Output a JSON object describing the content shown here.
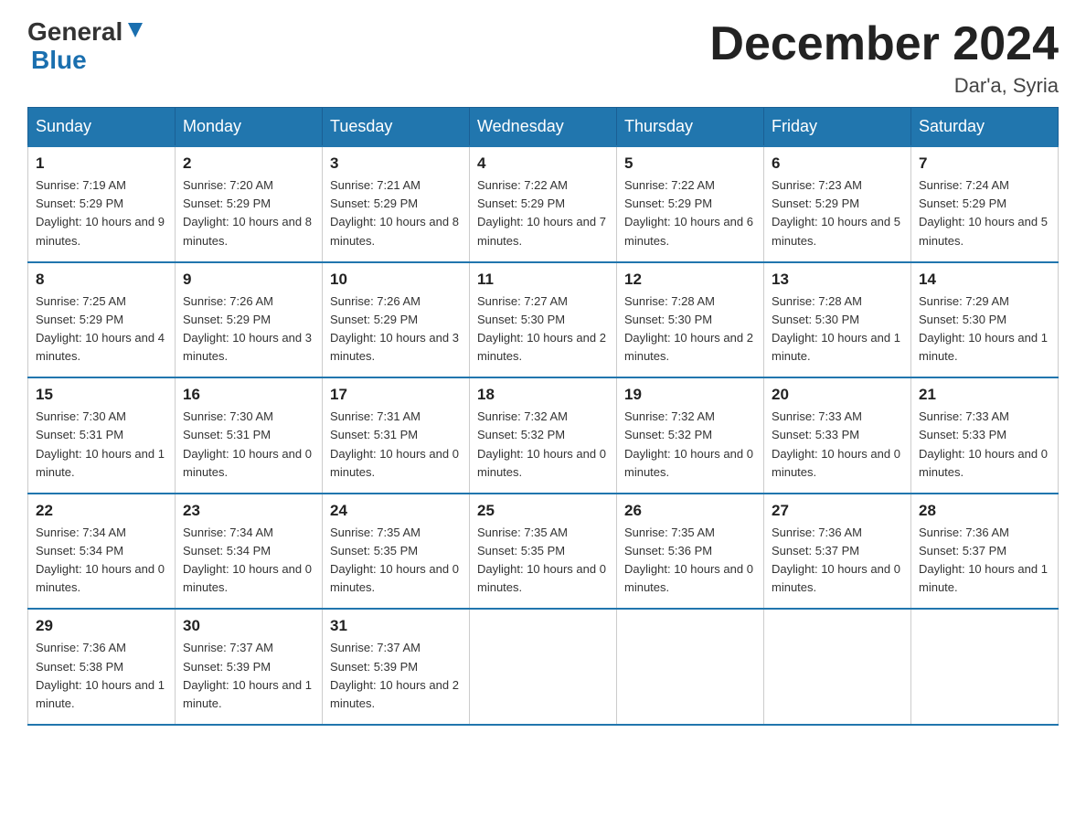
{
  "logo": {
    "text_general": "General",
    "text_blue": "Blue",
    "arrow_color": "#1a6faf"
  },
  "header": {
    "month_title": "December 2024",
    "location": "Dar'a, Syria"
  },
  "weekdays": [
    "Sunday",
    "Monday",
    "Tuesday",
    "Wednesday",
    "Thursday",
    "Friday",
    "Saturday"
  ],
  "weeks": [
    [
      {
        "day": "1",
        "sunrise": "7:19 AM",
        "sunset": "5:29 PM",
        "daylight": "10 hours and 9 minutes."
      },
      {
        "day": "2",
        "sunrise": "7:20 AM",
        "sunset": "5:29 PM",
        "daylight": "10 hours and 8 minutes."
      },
      {
        "day": "3",
        "sunrise": "7:21 AM",
        "sunset": "5:29 PM",
        "daylight": "10 hours and 8 minutes."
      },
      {
        "day": "4",
        "sunrise": "7:22 AM",
        "sunset": "5:29 PM",
        "daylight": "10 hours and 7 minutes."
      },
      {
        "day": "5",
        "sunrise": "7:22 AM",
        "sunset": "5:29 PM",
        "daylight": "10 hours and 6 minutes."
      },
      {
        "day": "6",
        "sunrise": "7:23 AM",
        "sunset": "5:29 PM",
        "daylight": "10 hours and 5 minutes."
      },
      {
        "day": "7",
        "sunrise": "7:24 AM",
        "sunset": "5:29 PM",
        "daylight": "10 hours and 5 minutes."
      }
    ],
    [
      {
        "day": "8",
        "sunrise": "7:25 AM",
        "sunset": "5:29 PM",
        "daylight": "10 hours and 4 minutes."
      },
      {
        "day": "9",
        "sunrise": "7:26 AM",
        "sunset": "5:29 PM",
        "daylight": "10 hours and 3 minutes."
      },
      {
        "day": "10",
        "sunrise": "7:26 AM",
        "sunset": "5:29 PM",
        "daylight": "10 hours and 3 minutes."
      },
      {
        "day": "11",
        "sunrise": "7:27 AM",
        "sunset": "5:30 PM",
        "daylight": "10 hours and 2 minutes."
      },
      {
        "day": "12",
        "sunrise": "7:28 AM",
        "sunset": "5:30 PM",
        "daylight": "10 hours and 2 minutes."
      },
      {
        "day": "13",
        "sunrise": "7:28 AM",
        "sunset": "5:30 PM",
        "daylight": "10 hours and 1 minute."
      },
      {
        "day": "14",
        "sunrise": "7:29 AM",
        "sunset": "5:30 PM",
        "daylight": "10 hours and 1 minute."
      }
    ],
    [
      {
        "day": "15",
        "sunrise": "7:30 AM",
        "sunset": "5:31 PM",
        "daylight": "10 hours and 1 minute."
      },
      {
        "day": "16",
        "sunrise": "7:30 AM",
        "sunset": "5:31 PM",
        "daylight": "10 hours and 0 minutes."
      },
      {
        "day": "17",
        "sunrise": "7:31 AM",
        "sunset": "5:31 PM",
        "daylight": "10 hours and 0 minutes."
      },
      {
        "day": "18",
        "sunrise": "7:32 AM",
        "sunset": "5:32 PM",
        "daylight": "10 hours and 0 minutes."
      },
      {
        "day": "19",
        "sunrise": "7:32 AM",
        "sunset": "5:32 PM",
        "daylight": "10 hours and 0 minutes."
      },
      {
        "day": "20",
        "sunrise": "7:33 AM",
        "sunset": "5:33 PM",
        "daylight": "10 hours and 0 minutes."
      },
      {
        "day": "21",
        "sunrise": "7:33 AM",
        "sunset": "5:33 PM",
        "daylight": "10 hours and 0 minutes."
      }
    ],
    [
      {
        "day": "22",
        "sunrise": "7:34 AM",
        "sunset": "5:34 PM",
        "daylight": "10 hours and 0 minutes."
      },
      {
        "day": "23",
        "sunrise": "7:34 AM",
        "sunset": "5:34 PM",
        "daylight": "10 hours and 0 minutes."
      },
      {
        "day": "24",
        "sunrise": "7:35 AM",
        "sunset": "5:35 PM",
        "daylight": "10 hours and 0 minutes."
      },
      {
        "day": "25",
        "sunrise": "7:35 AM",
        "sunset": "5:35 PM",
        "daylight": "10 hours and 0 minutes."
      },
      {
        "day": "26",
        "sunrise": "7:35 AM",
        "sunset": "5:36 PM",
        "daylight": "10 hours and 0 minutes."
      },
      {
        "day": "27",
        "sunrise": "7:36 AM",
        "sunset": "5:37 PM",
        "daylight": "10 hours and 0 minutes."
      },
      {
        "day": "28",
        "sunrise": "7:36 AM",
        "sunset": "5:37 PM",
        "daylight": "10 hours and 1 minute."
      }
    ],
    [
      {
        "day": "29",
        "sunrise": "7:36 AM",
        "sunset": "5:38 PM",
        "daylight": "10 hours and 1 minute."
      },
      {
        "day": "30",
        "sunrise": "7:37 AM",
        "sunset": "5:39 PM",
        "daylight": "10 hours and 1 minute."
      },
      {
        "day": "31",
        "sunrise": "7:37 AM",
        "sunset": "5:39 PM",
        "daylight": "10 hours and 2 minutes."
      },
      null,
      null,
      null,
      null
    ]
  ]
}
